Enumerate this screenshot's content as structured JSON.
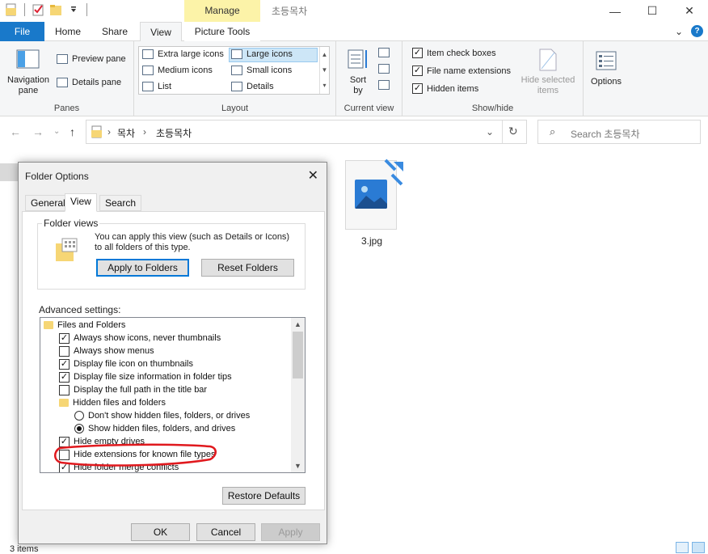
{
  "titlebar": {
    "manage": "Manage",
    "title": "초등목차",
    "minimize": "—",
    "maximize": "☐",
    "close": "✕"
  },
  "tabs": {
    "file": "File",
    "home": "Home",
    "share": "Share",
    "view": "View",
    "picture_tools": "Picture Tools"
  },
  "ribbon": {
    "panes": {
      "label": "Panes",
      "navigation_pane": "Navigation pane",
      "preview_pane": "Preview pane",
      "details_pane": "Details pane"
    },
    "layout": {
      "label": "Layout",
      "items": [
        "Extra large icons",
        "Large icons",
        "Medium icons",
        "Small icons",
        "List",
        "Details"
      ],
      "selected": "Large icons"
    },
    "current_view": {
      "label": "Current view",
      "sort_by": "Sort by"
    },
    "show_hide": {
      "label": "Show/hide",
      "item_check_boxes": "Item check boxes",
      "file_name_extensions": "File name extensions",
      "hidden_items": "Hidden items",
      "hide_selected_items": "Hide selected items"
    },
    "options": "Options"
  },
  "address": {
    "crumbs": [
      "목차",
      "초등목차"
    ],
    "search_placeholder": "Search 초등목차"
  },
  "files": [
    {
      "name": "3.jpg"
    }
  ],
  "status": {
    "items": "3 items"
  },
  "dialog": {
    "title": "Folder Options",
    "tabs": [
      "General",
      "View",
      "Search"
    ],
    "active_tab": "View",
    "folder_views": {
      "legend": "Folder views",
      "text": "You can apply this view (such as Details or Icons) to all folders of this type.",
      "apply": "Apply to Folders",
      "reset": "Reset Folders"
    },
    "advanced_label": "Advanced settings:",
    "tree": [
      {
        "type": "folder",
        "indent": 0,
        "label": "Files and Folders"
      },
      {
        "type": "checkbox",
        "indent": 1,
        "checked": true,
        "label": "Always show icons, never thumbnails"
      },
      {
        "type": "checkbox",
        "indent": 1,
        "checked": false,
        "label": "Always show menus"
      },
      {
        "type": "checkbox",
        "indent": 1,
        "checked": true,
        "label": "Display file icon on thumbnails"
      },
      {
        "type": "checkbox",
        "indent": 1,
        "checked": true,
        "label": "Display file size information in folder tips"
      },
      {
        "type": "checkbox",
        "indent": 1,
        "checked": false,
        "label": "Display the full path in the title bar"
      },
      {
        "type": "folder",
        "indent": 1,
        "label": "Hidden files and folders"
      },
      {
        "type": "radio",
        "indent": 2,
        "checked": false,
        "label": "Don't show hidden files, folders, or drives"
      },
      {
        "type": "radio",
        "indent": 2,
        "checked": true,
        "label": "Show hidden files, folders, and drives"
      },
      {
        "type": "checkbox",
        "indent": 1,
        "checked": true,
        "label": "Hide empty drives"
      },
      {
        "type": "checkbox",
        "indent": 1,
        "checked": false,
        "label": "Hide extensions for known file types"
      },
      {
        "type": "checkbox",
        "indent": 1,
        "checked": true,
        "label": "Hide folder merge conflicts"
      }
    ],
    "restore_defaults": "Restore Defaults",
    "ok": "OK",
    "cancel": "Cancel",
    "apply": "Apply"
  },
  "colors": {
    "file_tab": "#1979ca",
    "manage_tab": "#fcf3a8",
    "annotation": "#e0191e"
  }
}
